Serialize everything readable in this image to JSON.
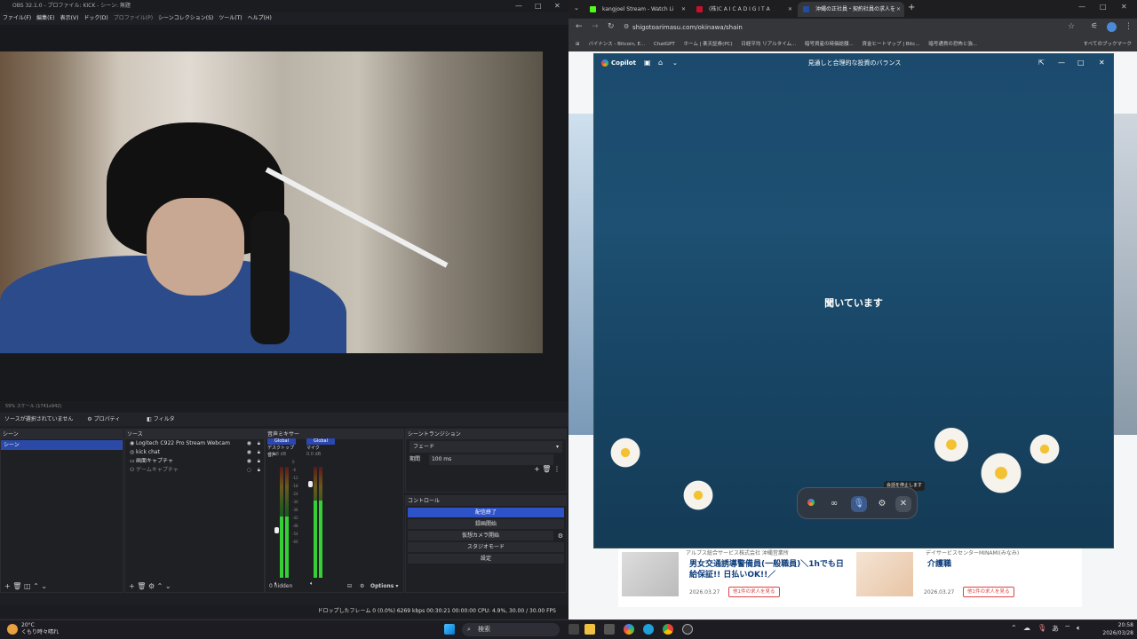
{
  "obs": {
    "title": "OBS 32.1.0 - プロファイル: KICK - シーン: 無題",
    "menu": [
      "ファイル(F)",
      "編集(E)",
      "表示(V)",
      "ドック(D)",
      "プロファイル(P)",
      "シーンコレクション(S)",
      "ツール(T)",
      "ヘルプ(H)"
    ],
    "status_strip": "59%    スケール (1741x942)",
    "source_bar": {
      "no_source": "ソースが選択されていません",
      "properties": "プロパティ",
      "filters": "フィルタ"
    },
    "scenes": {
      "header": "シーン",
      "items": [
        "シーン"
      ]
    },
    "sources": {
      "header": "ソース",
      "items": [
        "Logitech C922 Pro Stream Webcam",
        "kick chat",
        "画面キャプチャ",
        "ゲームキャプチャ"
      ]
    },
    "mixer": {
      "header": "音声ミキサー",
      "channels": [
        {
          "badge": "Global",
          "name": "デスクトップ音声",
          "db": "-20.8 dB",
          "level": 0.55
        },
        {
          "badge": "Global",
          "name": "マイク",
          "db": "0.0 dB",
          "level": 0.7
        }
      ],
      "ticks": [
        "0",
        "-6",
        "-12",
        "-18",
        "-24",
        "-30",
        "-36",
        "-42",
        "-48",
        "-54",
        "-60"
      ],
      "hidden": "0 hidden",
      "options": "Options"
    },
    "transitions": {
      "header": "シーントランジション",
      "type": "フェード",
      "duration_label": "期間",
      "duration": "100 ms"
    },
    "controls": {
      "header": "コントロール",
      "buttons": [
        "配信終了",
        "録画開始",
        "仮想カメラ開始",
        "スタジオモード",
        "設定"
      ]
    },
    "status_bar": "ドロップしたフレーム 0 (0.0%)   6269 kbps   00:30:21   00:00:00   CPU: 4.9%, 30.00 / 30.00 FPS"
  },
  "chrome": {
    "tabs": [
      {
        "title": "kangjoel Stream - Watch Li",
        "fav_color": "#53fc18",
        "active": false
      },
      {
        "title": "(株)C A I C A  D I G I T A",
        "fav_color": "#c8102e",
        "active": false
      },
      {
        "title": "沖縄の正社員・契約社員の求人を",
        "fav_color": "#1f4ea3",
        "active": true
      }
    ],
    "url": "shigotoarimasu.com/okinawa/shain",
    "bookmarks": [
      "バイナンス - Bitcoin, E...",
      "ChatGPT",
      "ホーム | 楽天証券(PC)",
      "日経平均 リアルタイム...",
      "暗号資産の時価総額...",
      "資金ヒートマップ | Bitc...",
      "暗号通貨の恐怖と強...",
      "すべてのブックマーク"
    ]
  },
  "copilot": {
    "brand": "Copilot",
    "title": "見通しと合理的な投資のバランス",
    "status": "聞いています",
    "tooltip": "会話を停止します"
  },
  "jobs": [
    {
      "company": "アルプス総合サービス株式会社 沖縄営業所",
      "title": "男女交通誘導警備員(一般職員)＼1hでも日給保証!! 日払いOK!!／",
      "date": "2026.03.27",
      "more": "他1件の求人を見る"
    },
    {
      "company": "デイサービスセンターMINAMI(みなみ)",
      "title": "介護職",
      "date": "2026.03.27",
      "more": "他1件の求人を見る"
    }
  ],
  "taskbar": {
    "weather_temp": "20°C",
    "weather_desc": "くもり時々晴れ",
    "search": "検索",
    "time": "20:58",
    "date": "2026/03/28"
  }
}
